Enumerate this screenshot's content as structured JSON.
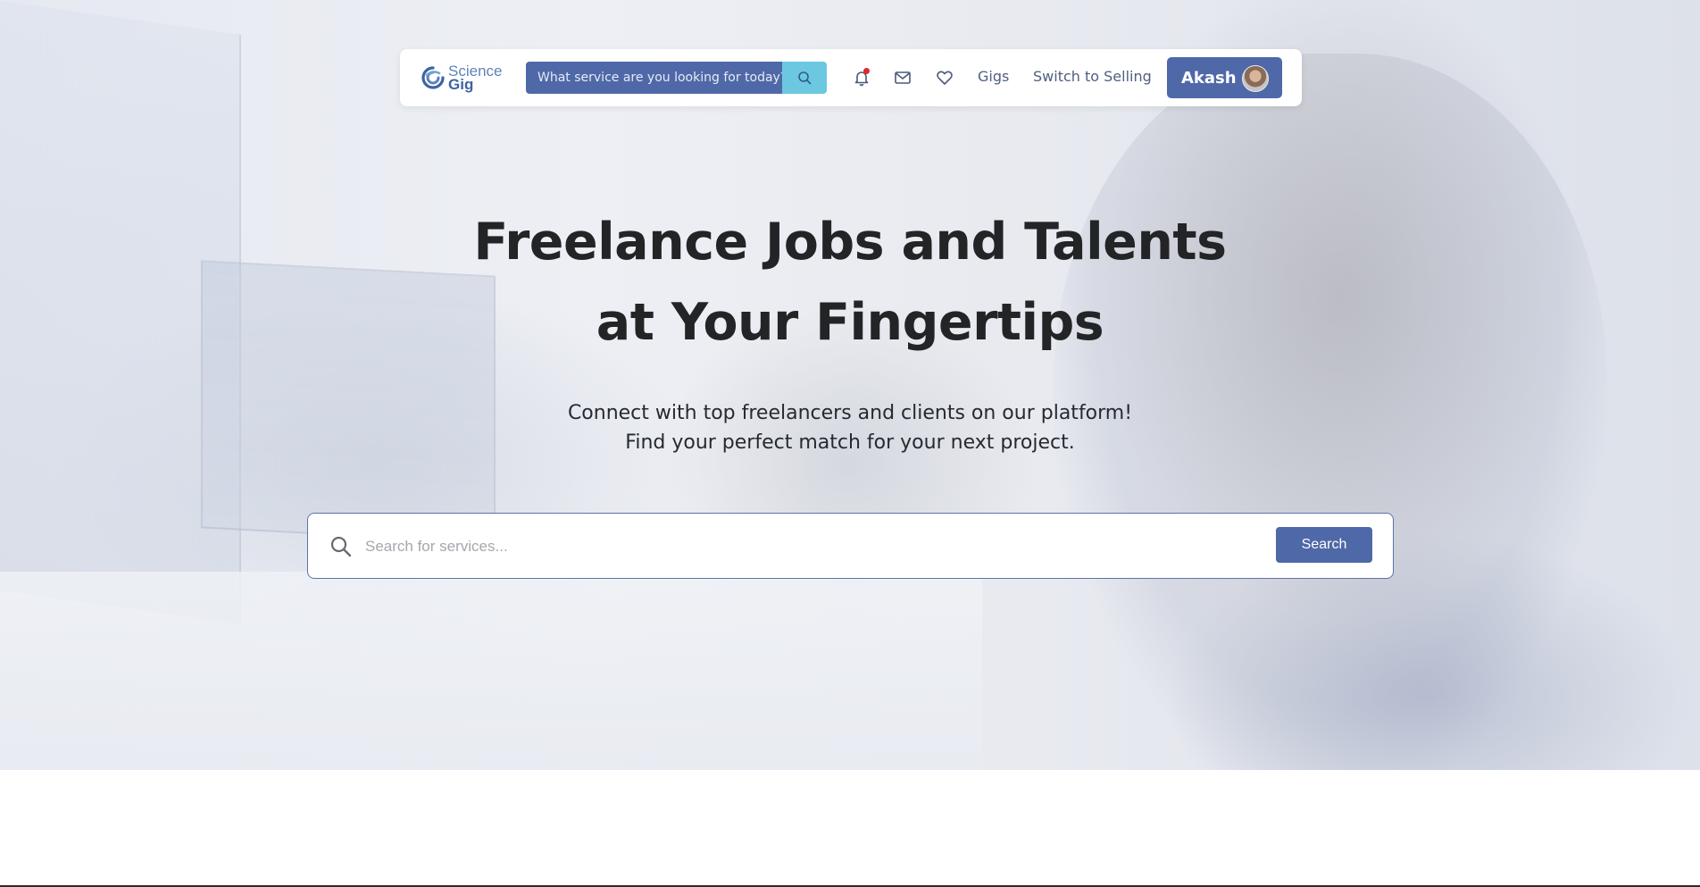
{
  "brand": {
    "logo_line1": "Science",
    "logo_line2": "Gig",
    "accent": "#4f68a8",
    "search_accent": "#6cc8e0"
  },
  "navbar": {
    "search_placeholder": "What service are you looking for today?",
    "icons": [
      "search-icon",
      "bell-icon",
      "mail-icon",
      "heart-icon"
    ],
    "notification_dot_color": "#e0282e",
    "links": {
      "gigs": "Gigs",
      "switch": "Switch to Selling"
    },
    "user": {
      "name": "Akash"
    }
  },
  "hero": {
    "headline_line1": "Freelance Jobs and Talents",
    "headline_line2": "at Your Fingertips",
    "subline_line1": "Connect with top freelancers and clients on our platform!",
    "subline_line2": "Find your perfect match for your next project.",
    "search": {
      "placeholder": "Search for services...",
      "button_label": "Search"
    }
  }
}
